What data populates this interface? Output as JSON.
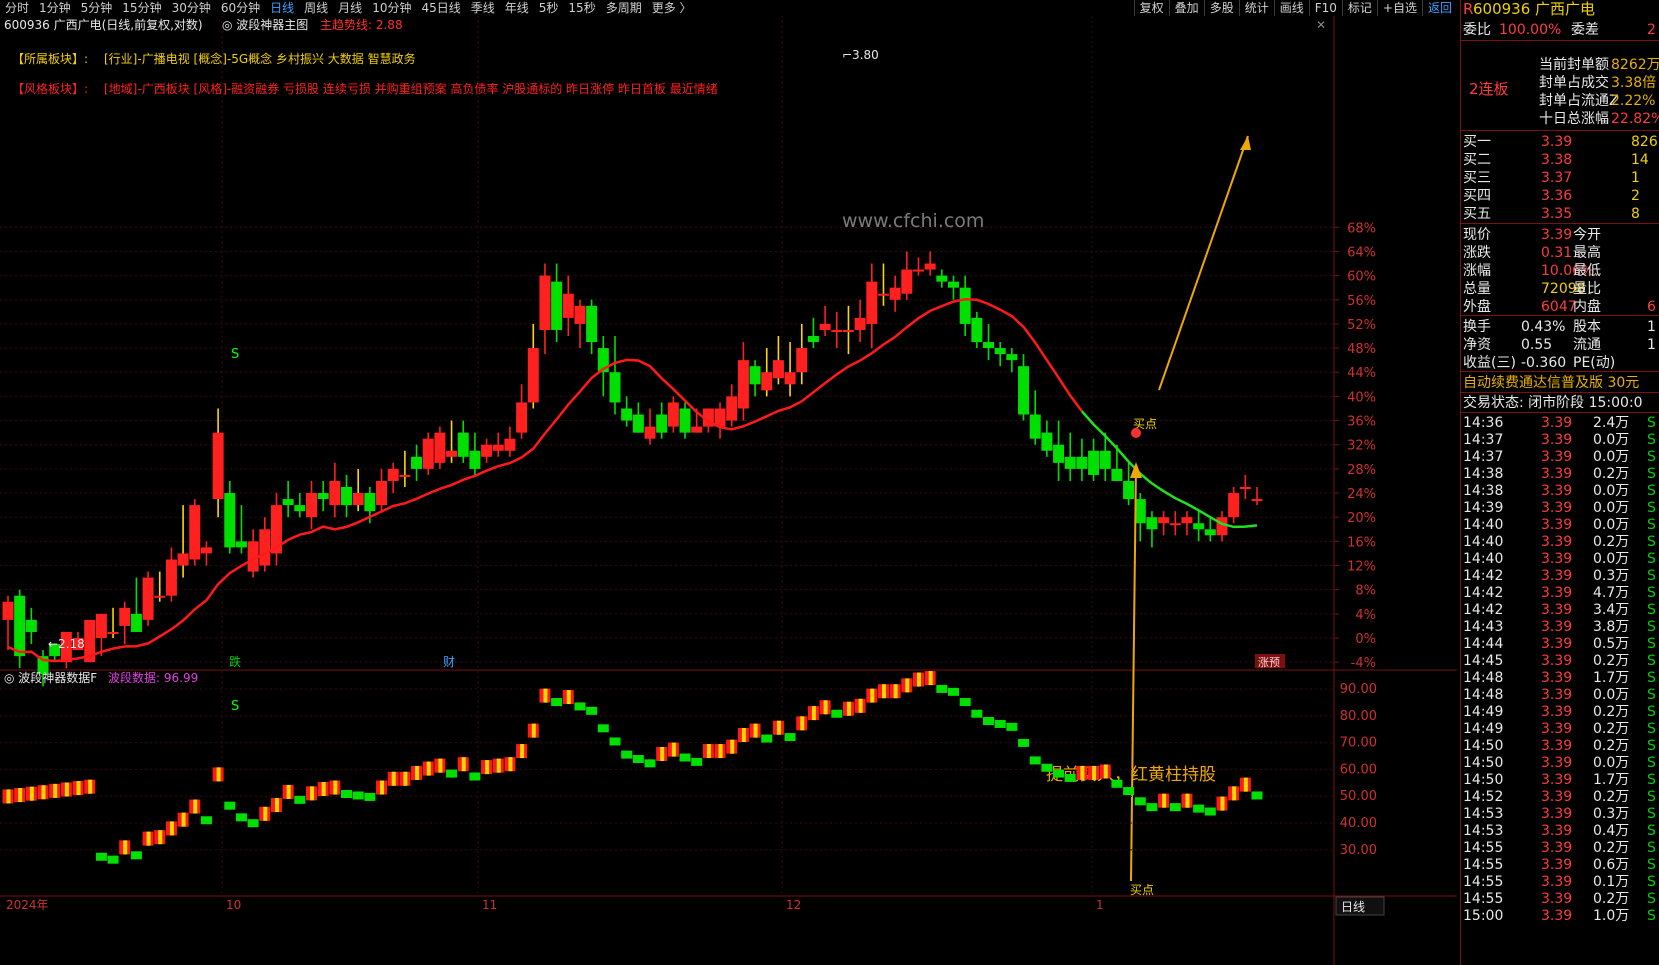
{
  "nav": {
    "periods": [
      "分时",
      "1分钟",
      "5分钟",
      "15分钟",
      "30分钟",
      "60分钟",
      "日线",
      "周线",
      "月线",
      "10分钟",
      "45日线",
      "季线",
      "年线",
      "5秒",
      "15秒",
      "多周期",
      "更多 〉"
    ],
    "active": "日线",
    "tools": [
      "复权",
      "叠加",
      "多股",
      "统计",
      "画线",
      "F10",
      "标记",
      "+自选",
      "返回"
    ]
  },
  "chart_data": {
    "type": "candlestick",
    "title": "600936 广西广电(日线,前复权,对数)",
    "indicator": "波段神器主图",
    "trend_label": "主趋势线:",
    "trend_value": "2.88",
    "axis_ticks": [
      "68%",
      "64%",
      "60%",
      "56%",
      "52%",
      "48%",
      "44%",
      "40%",
      "36%",
      "32%",
      "28%",
      "24%",
      "20%",
      "16%",
      "12%",
      "8%",
      "4%",
      "0%",
      "-4%"
    ],
    "x_labels": [
      "2024年",
      "10",
      "11",
      "12",
      "1"
    ],
    "high_label": "3.80",
    "low_label": "←2.18",
    "markers": [
      "S",
      "跌",
      "财",
      "涨预",
      "买点",
      "买点"
    ],
    "candles": [
      [
        3,
        6,
        -2,
        7
      ],
      [
        7,
        -3,
        -5,
        8
      ],
      [
        3,
        1,
        -1,
        5
      ],
      [
        -3,
        -6,
        -8,
        -2
      ],
      [
        -1,
        -3,
        -4,
        -1
      ],
      [
        -4,
        1,
        -5,
        1
      ],
      [
        -2,
        0,
        -2,
        1
      ],
      [
        -4,
        3,
        -4,
        3
      ],
      [
        0,
        4,
        -3,
        4
      ],
      [
        1,
        1,
        0,
        5
      ],
      [
        2,
        5,
        -1,
        6
      ],
      [
        4,
        1,
        1,
        10
      ],
      [
        3,
        10,
        2,
        11
      ],
      [
        7,
        7,
        6,
        11
      ],
      [
        7,
        13,
        6,
        15
      ],
      [
        12,
        14,
        10,
        22
      ],
      [
        13,
        22,
        12,
        23
      ],
      [
        14,
        15,
        12,
        16
      ],
      [
        23,
        34,
        20,
        38
      ],
      [
        24,
        15,
        14,
        26
      ],
      [
        16,
        15,
        14,
        22
      ],
      [
        11,
        16,
        10,
        18
      ],
      [
        12,
        18,
        11,
        20
      ],
      [
        14,
        22,
        12,
        24
      ],
      [
        23,
        22,
        20,
        26
      ],
      [
        22,
        21,
        20,
        24
      ],
      [
        20,
        24,
        18,
        26
      ],
      [
        24,
        23,
        21,
        26
      ],
      [
        22,
        26,
        20,
        29
      ],
      [
        25,
        22,
        20,
        27
      ],
      [
        22,
        24,
        21,
        28
      ],
      [
        24,
        21,
        19,
        25
      ],
      [
        22,
        26,
        21,
        28
      ],
      [
        26,
        28,
        24,
        29
      ],
      [
        27,
        27,
        25,
        31
      ],
      [
        30,
        28,
        26,
        32
      ],
      [
        28,
        33,
        27,
        34
      ],
      [
        29,
        34,
        28,
        35
      ],
      [
        30,
        31,
        29,
        36
      ],
      [
        34,
        30,
        29,
        36
      ],
      [
        31,
        28,
        27,
        34
      ],
      [
        30,
        32,
        29,
        33
      ],
      [
        31,
        32,
        30,
        34
      ],
      [
        31,
        33,
        30,
        35
      ],
      [
        34,
        39,
        33,
        42
      ],
      [
        39,
        48,
        38,
        52
      ],
      [
        51,
        60,
        47,
        62
      ],
      [
        59,
        51,
        49,
        62
      ],
      [
        53,
        57,
        50,
        60
      ],
      [
        52,
        55,
        48,
        56
      ],
      [
        55,
        49,
        47,
        56
      ],
      [
        48,
        44,
        40,
        50
      ],
      [
        44,
        39,
        37,
        50
      ],
      [
        38,
        36,
        35,
        40
      ],
      [
        37,
        34,
        34,
        39
      ],
      [
        33,
        35,
        32,
        38
      ],
      [
        37,
        34,
        33,
        39
      ],
      [
        35,
        39,
        34,
        40
      ],
      [
        38,
        34,
        33,
        39
      ],
      [
        34,
        35,
        34,
        38
      ],
      [
        35,
        38,
        34,
        38
      ],
      [
        35,
        38,
        33,
        39
      ],
      [
        36,
        40,
        35,
        42
      ],
      [
        38,
        46,
        36,
        49
      ],
      [
        45,
        42,
        40,
        46
      ],
      [
        41,
        44,
        40,
        48
      ],
      [
        43,
        46,
        42,
        50
      ],
      [
        42,
        44,
        40,
        49
      ],
      [
        44,
        48,
        42,
        52
      ],
      [
        50,
        49,
        48,
        53
      ],
      [
        51,
        52,
        50,
        55
      ],
      [
        51,
        51,
        48,
        54
      ],
      [
        51,
        51,
        47,
        55
      ],
      [
        51,
        53,
        49,
        56
      ],
      [
        52,
        59,
        48,
        62
      ],
      [
        57,
        57,
        55,
        62
      ],
      [
        56,
        58,
        54,
        60
      ],
      [
        57,
        61,
        56,
        64
      ],
      [
        61,
        61,
        60,
        63
      ],
      [
        61,
        62,
        60,
        64
      ],
      [
        60,
        59,
        58,
        61
      ],
      [
        59,
        58,
        56,
        60
      ],
      [
        58,
        52,
        50,
        60
      ],
      [
        53,
        49,
        48,
        54
      ],
      [
        49,
        48,
        46,
        52
      ],
      [
        48,
        47,
        45,
        49
      ],
      [
        47,
        46,
        44,
        48
      ],
      [
        45,
        37,
        36,
        47
      ],
      [
        37,
        33,
        32,
        41
      ],
      [
        34,
        31,
        30,
        36
      ],
      [
        32,
        29,
        26,
        36
      ],
      [
        30,
        28,
        26,
        34
      ],
      [
        30,
        28,
        26,
        33
      ],
      [
        31,
        27,
        26,
        33
      ],
      [
        31,
        28,
        26,
        34
      ],
      [
        28,
        26,
        26,
        32
      ],
      [
        26,
        23,
        22,
        29
      ],
      [
        23,
        19,
        16,
        24
      ],
      [
        20,
        18,
        15,
        21
      ],
      [
        19,
        20,
        17,
        21
      ],
      [
        19,
        19,
        17,
        21
      ],
      [
        19,
        20,
        17,
        21
      ],
      [
        19,
        18,
        16,
        21
      ],
      [
        18,
        17,
        16,
        20
      ],
      [
        17,
        20,
        16,
        21
      ],
      [
        20,
        24,
        19,
        25
      ],
      [
        25,
        25,
        23,
        27
      ],
      [
        23,
        23,
        22,
        25
      ]
    ]
  },
  "board": {
    "label1": "【所属板块】:",
    "text1": "[行业]-广播电视 [概念]-5G概念 乡村振兴 大数据 智慧政务",
    "label2": "【风格板块】:",
    "text2": "[地域]-广西板块 [风格]-融资融券 亏损股 连续亏损 并购重组预案 高负债率 沪股通标的 昨日涨停 昨日首板 最近情绪"
  },
  "watermark": "www.cfchi.com",
  "sub": {
    "title": "波段神器数据F",
    "label": "波段数据:",
    "value": "96.99",
    "ticks": [
      "90.00",
      "80.00",
      "70.00",
      "60.00",
      "50.00",
      "40.00",
      "30.00"
    ],
    "annotation": "提前买入，红黄柱持股",
    "period_button": "日线"
  },
  "quote": {
    "code": "600936",
    "name": "广西广电",
    "weibi_label": "委比",
    "weibi": "100.00%",
    "weicha_label": "委差",
    "weicha": "2",
    "board_tag": "2连板",
    "seal_label": "当前封单额",
    "seal": "8262万",
    "seal_deal_label": "封单占成交",
    "seal_deal": "3.38倍",
    "seal_float_label": "封单占流通Z",
    "seal_float": "2.22%",
    "ten_label": "十日总涨幅",
    "ten": "22.82%"
  },
  "book": [
    {
      "label": "买一",
      "price": "3.39",
      "vol": "826"
    },
    {
      "label": "买二",
      "price": "3.38",
      "vol": "14"
    },
    {
      "label": "买三",
      "price": "3.37",
      "vol": "1"
    },
    {
      "label": "买四",
      "price": "3.36",
      "vol": "2"
    },
    {
      "label": "买五",
      "price": "3.35",
      "vol": "8"
    }
  ],
  "stats": [
    [
      "现价",
      "3.39",
      "今开",
      ""
    ],
    [
      "涨跌",
      "0.31",
      "最高",
      ""
    ],
    [
      "涨幅",
      "10.06%",
      "最低",
      ""
    ],
    [
      "总量",
      "72098",
      "量比",
      ""
    ],
    [
      "外盘",
      "6047",
      "内盘",
      "6"
    ]
  ],
  "stats2": [
    [
      "换手",
      "0.43%",
      "股本",
      "1"
    ],
    [
      "净资",
      "0.55",
      "流通",
      "1"
    ],
    [
      "收益(三)",
      "-0.360",
      "PE(动)",
      ""
    ]
  ],
  "ad": "自动续费通达信普及版  30元",
  "trade_state": "交易状态: 闭市阶段  15:00:0",
  "ticks": [
    [
      "14:36",
      "3.39",
      "2.4万"
    ],
    [
      "14:37",
      "3.39",
      "0.0万"
    ],
    [
      "14:37",
      "3.39",
      "0.0万"
    ],
    [
      "14:38",
      "3.39",
      "0.2万"
    ],
    [
      "14:38",
      "3.39",
      "0.0万"
    ],
    [
      "14:39",
      "3.39",
      "0.0万"
    ],
    [
      "14:40",
      "3.39",
      "0.0万"
    ],
    [
      "14:40",
      "3.39",
      "0.2万"
    ],
    [
      "14:40",
      "3.39",
      "0.0万"
    ],
    [
      "14:42",
      "3.39",
      "0.3万"
    ],
    [
      "14:42",
      "3.39",
      "4.7万"
    ],
    [
      "14:42",
      "3.39",
      "3.4万"
    ],
    [
      "14:43",
      "3.39",
      "3.8万"
    ],
    [
      "14:44",
      "3.39",
      "0.5万"
    ],
    [
      "14:45",
      "3.39",
      "0.2万"
    ],
    [
      "14:48",
      "3.39",
      "1.7万"
    ],
    [
      "14:48",
      "3.39",
      "0.0万"
    ],
    [
      "14:49",
      "3.39",
      "0.2万"
    ],
    [
      "14:49",
      "3.39",
      "0.2万"
    ],
    [
      "14:50",
      "3.39",
      "0.2万"
    ],
    [
      "14:50",
      "3.39",
      "0.0万"
    ],
    [
      "14:50",
      "3.39",
      "1.7万"
    ],
    [
      "14:52",
      "3.39",
      "0.2万"
    ],
    [
      "14:53",
      "3.39",
      "0.3万"
    ],
    [
      "14:53",
      "3.39",
      "0.4万"
    ],
    [
      "14:55",
      "3.39",
      "0.2万"
    ],
    [
      "14:55",
      "3.39",
      "0.6万"
    ],
    [
      "14:55",
      "3.39",
      "0.1万"
    ],
    [
      "14:55",
      "3.39",
      "0.2万"
    ],
    [
      "15:00",
      "3.39",
      "1.0万"
    ]
  ]
}
